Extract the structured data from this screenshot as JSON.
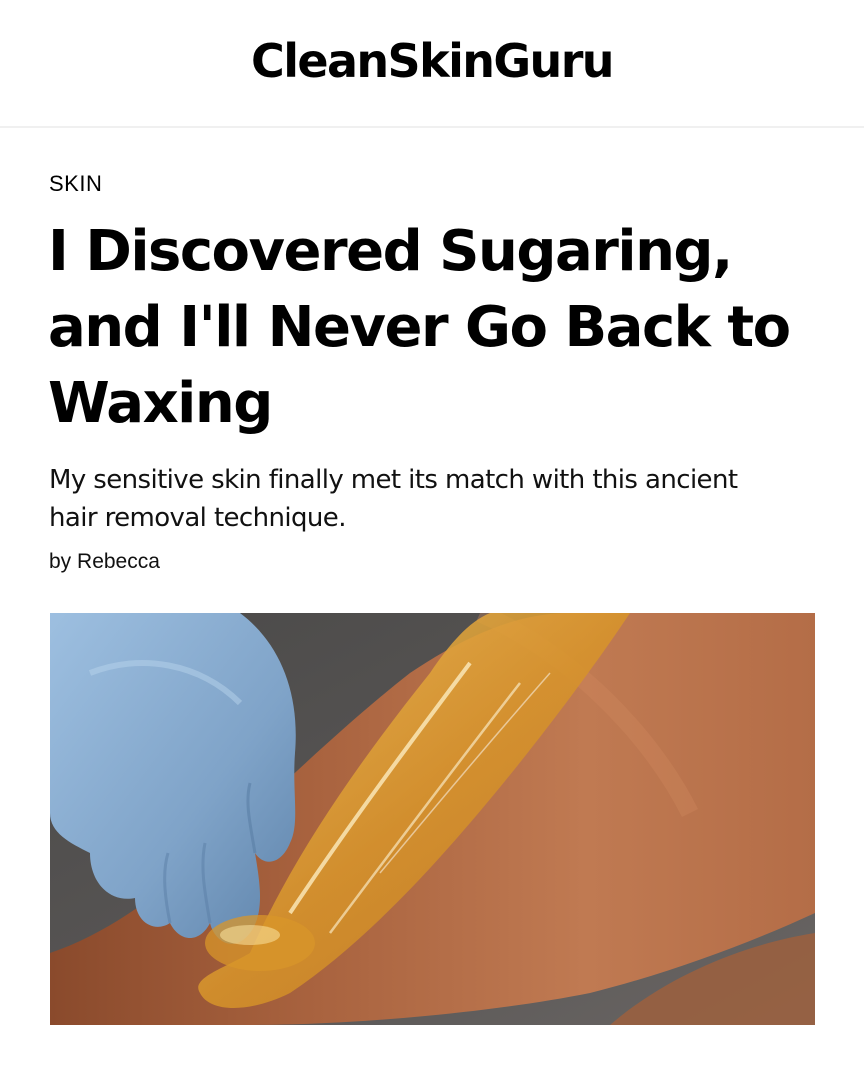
{
  "site": {
    "logo_text": "CleanSkinGuru"
  },
  "article": {
    "category": "SKIN",
    "title": "I Discovered Sugaring, and I'll Never Go Back to Waxing",
    "dek": "My sensitive skin finally met its match with this ancient hair removal technique.",
    "byline_prefix": "by",
    "author": "Rebecca"
  },
  "hero_image": {
    "subject": "gloved hand applying sugaring paste to a leg",
    "colors": {
      "background": "#555353",
      "skin": "#b5714a",
      "glove": "#8fb3d6",
      "sugar_paste": "#d99a2b"
    }
  }
}
